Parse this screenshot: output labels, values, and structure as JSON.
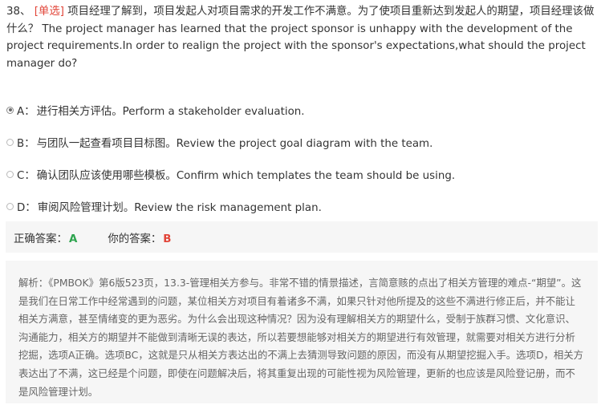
{
  "question": {
    "number": "38、",
    "type_label": "[单选]",
    "text": "项目经理了解到，项目发起人对项目需求的开发工作不满意。为了使项目重新达到发起人的期望，项目经理该做什么？ The project manager has learned that the project sponsor is unhappy with the development of the project requirements.In order to realign the project with the sponsor's expectations,what should the project manager do?"
  },
  "options": [
    {
      "letter": "A：",
      "text": "进行相关方评估。Perform a stakeholder evaluation.",
      "selected": true
    },
    {
      "letter": "B：",
      "text": "与团队一起查看项目目标图。Review the project goal diagram with the team.",
      "selected": false
    },
    {
      "letter": "C：",
      "text": "确认团队应该使用哪些模板。Confirm which templates the team should be using.",
      "selected": false
    },
    {
      "letter": "D：",
      "text": "审阅风险管理计划。Review the risk management plan.",
      "selected": false
    }
  ],
  "answer": {
    "correct_label": "正确答案：",
    "correct_value": "A",
    "yours_label": "你的答案：",
    "yours_value": "B"
  },
  "analysis": {
    "text": "解析：《PMBOK》第6版523页，13.3-管理相关方参与。非常不错的情景描述，言简意赅的点出了相关方管理的难点-“期望”。这是我们在日常工作中经常遇到的问题，某位相关方对项目有着诸多不满，如果只针对他所提及的这些不满进行修正后，并不能让相关方满意，甚至情绪变的更为恶劣。为什么会出现这种情况？因为没有理解相关方的期望什么，受制于族群习惯、文化意识、沟通能力，相关方的期望并不能做到清晰无误的表达，所以若要想能够对相关方的期望进行有效管理，就需要对相关方进行分析挖掘，选项A正确。选项BC，这就是只从相关方表达出的不满上去猜测导致问题的原因，而没有从期望挖掘入手。选项D，相关方表达出了不满，这已经是个问题，即使在问题解决后，将其重复出现的可能性视为风险管理，更新的也应该是风险登记册，而不是风险管理计划。"
  },
  "colors": {
    "type_label": "#e2463a",
    "correct": "#2ea44f",
    "wrong": "#e2463a",
    "panel_bg": "#f6f6f6"
  }
}
